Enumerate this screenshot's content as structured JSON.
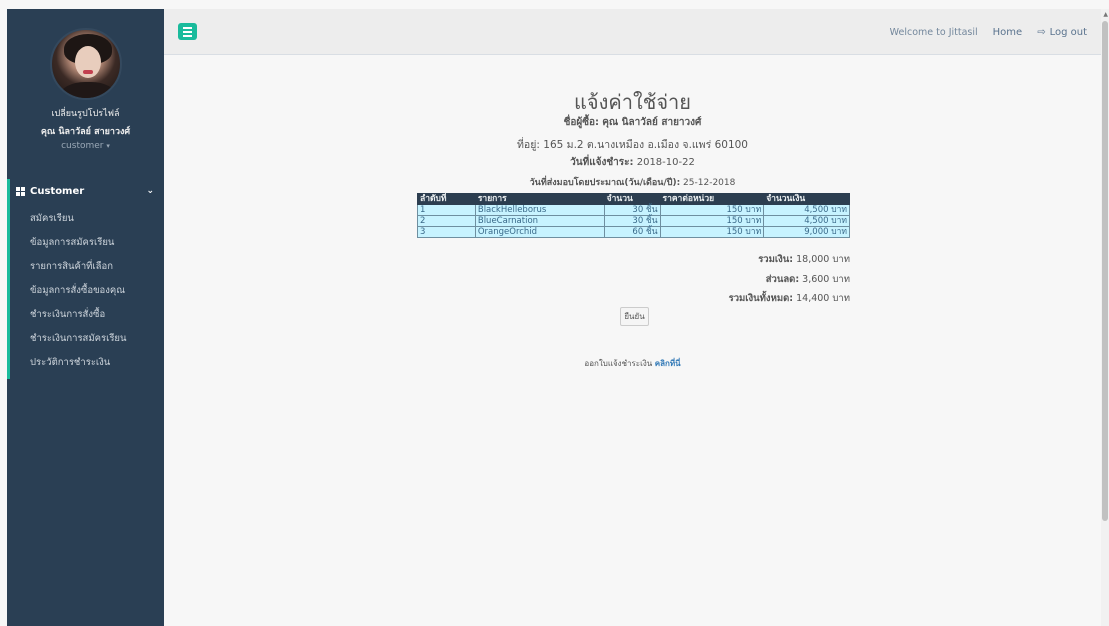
{
  "sidebar": {
    "change_photo": "เปลี่ยนรูปโปรไฟล์",
    "user_name": "คุณ นิลาวัลย์ สายาวงศ์",
    "user_role": "customer",
    "menu_title": "Customer",
    "items": [
      {
        "label": "สมัครเรียน"
      },
      {
        "label": "ข้อมูลการสมัครเรียน"
      },
      {
        "label": "รายการสินค้าที่เลือก"
      },
      {
        "label": "ข้อมูลการสั่งซื้อของคุณ"
      },
      {
        "label": "ชำระเงินการสั่งซื้อ"
      },
      {
        "label": "ชำระเงินการสมัครเรียน"
      },
      {
        "label": "ประวัติการชำระเงิน"
      }
    ]
  },
  "topnav": {
    "welcome": "Welcome to Jittasil",
    "home": "Home",
    "logout": "Log out"
  },
  "invoice": {
    "title": "แจ้งค่าใช้จ่าย",
    "buyer_label": "ชื่อผู้ซื้อ:",
    "buyer": "คุณ นิลาวัลย์ สายาวงศ์",
    "address_label": "ที่อยู่:",
    "address": "165 ม.2 ต.นางเหมือง อ.เมือง จ.แพร่ 60100",
    "bill_date_label": "วันที่แจ้งชำระ:",
    "bill_date": "2018-10-22",
    "delivery_label": "วันที่ส่งมอบโดยประมาณ(วัน/เดือน/ปี):",
    "delivery_date": "25-12-2018",
    "columns": [
      "ลำดับที่",
      "รายการ",
      "จำนวน",
      "ราคาต่อหน่วย",
      "จำนวนเงิน"
    ],
    "rows": [
      {
        "no": "1",
        "item": "BlackHelleborus",
        "qty": "30 ชิ้น",
        "unit_price": "150 บาท",
        "amount": "4,500 บาท"
      },
      {
        "no": "2",
        "item": "BlueCarnation",
        "qty": "30 ชิ้น",
        "unit_price": "150 บาท",
        "amount": "4,500 บาท"
      },
      {
        "no": "3",
        "item": "OrangeOrchid",
        "qty": "60 ชิ้น",
        "unit_price": "150 บาท",
        "amount": "9,000 บาท"
      }
    ],
    "subtotal_label": "รวมเงิน:",
    "subtotal": "18,000 บาท",
    "discount_label": "ส่วนลด:",
    "discount": "3,600 บาท",
    "grand_total_label": "รวมเงินทั้งหมด:",
    "grand_total": "14,400 บาท",
    "confirm": "ยืนยัน",
    "receipt_text": "ออกใบแจ้งชำระเงิน",
    "receipt_link": "คลิกที่นี่"
  }
}
